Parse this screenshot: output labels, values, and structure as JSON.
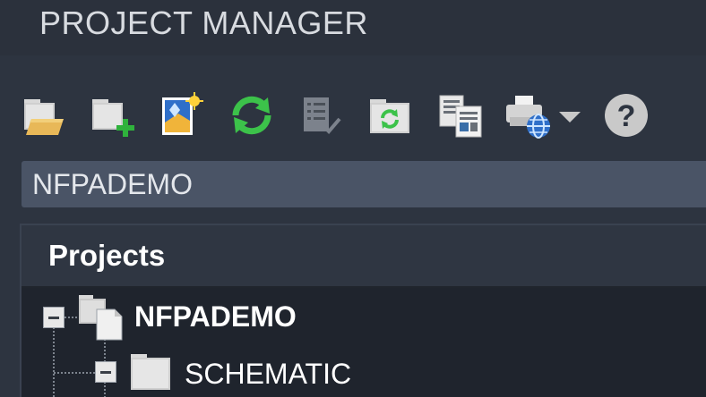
{
  "window": {
    "title": "PROJECT MANAGER"
  },
  "toolbar": {
    "buttons": [
      {
        "name": "open-project-icon"
      },
      {
        "name": "new-project-icon"
      },
      {
        "name": "new-drawing-icon"
      },
      {
        "name": "refresh-icon"
      },
      {
        "name": "project-tasks-icon"
      },
      {
        "name": "update-retag-icon"
      },
      {
        "name": "title-block-update-icon"
      },
      {
        "name": "publish-plot-icon"
      },
      {
        "name": "dropdown-arrow-icon"
      },
      {
        "name": "help-icon"
      }
    ]
  },
  "project_select": {
    "value": "NFPADEMO"
  },
  "tree": {
    "header": "Projects",
    "items": [
      {
        "label": "NFPADEMO",
        "level": 0,
        "expanded": true,
        "icon": "project-icon"
      },
      {
        "label": "SCHEMATIC",
        "level": 1,
        "expanded": true,
        "icon": "folder-icon"
      }
    ]
  },
  "colors": {
    "background": "#1e232c",
    "panel": "#2d3440",
    "select_bg": "#4a5466",
    "refresh_green": "#3cc24a",
    "add_green": "#2fb23c"
  }
}
